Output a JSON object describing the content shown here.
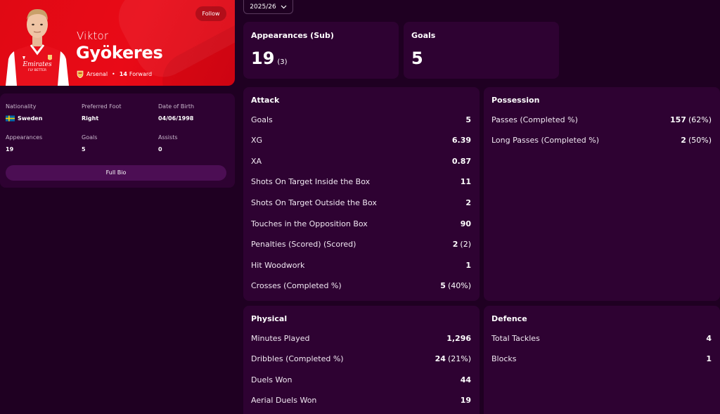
{
  "profile": {
    "first_name": "Viktor",
    "last_name": "Gyökeres",
    "club": "Arsenal",
    "shirt_number": "14",
    "position": "Forward",
    "follow_label": "Follow",
    "shirt_sponsor_line1": "Emirates",
    "shirt_sponsor_line2": "FLY BETTER"
  },
  "bio": {
    "nationality_label": "Nationality",
    "nationality": "Sweden",
    "foot_label": "Preferred Foot",
    "foot": "Right",
    "dob_label": "Date of Birth",
    "dob": "04/06/1998",
    "appearances_label": "Appearances",
    "appearances": "19",
    "goals_label": "Goals",
    "goals": "5",
    "assists_label": "Assists",
    "assists": "0",
    "full_bio_label": "Full Bio"
  },
  "season": {
    "selected": "2025/26"
  },
  "summary": {
    "appearances_label": "Appearances (Sub)",
    "appearances": "19",
    "appearances_sub": "(3)",
    "goals_label": "Goals",
    "goals": "5"
  },
  "attack": {
    "title": "Attack",
    "rows": [
      {
        "name": "Goals",
        "value": "5",
        "extra": ""
      },
      {
        "name": "XG",
        "value": "6.39",
        "extra": ""
      },
      {
        "name": "XA",
        "value": "0.87",
        "extra": ""
      },
      {
        "name": "Shots On Target Inside the Box",
        "value": "11",
        "extra": ""
      },
      {
        "name": "Shots On Target Outside the Box",
        "value": "2",
        "extra": ""
      },
      {
        "name": "Touches in the Opposition Box",
        "value": "90",
        "extra": ""
      },
      {
        "name": "Penalties (Scored) (Scored)",
        "value": "2",
        "extra": "(2)"
      },
      {
        "name": "Hit Woodwork",
        "value": "1",
        "extra": ""
      },
      {
        "name": "Crosses (Completed %)",
        "value": "5",
        "extra": "(40%)"
      }
    ]
  },
  "possession": {
    "title": "Possession",
    "rows": [
      {
        "name": "Passes (Completed %)",
        "value": "157",
        "extra": "(62%)"
      },
      {
        "name": "Long Passes (Completed %)",
        "value": "2",
        "extra": "(50%)"
      }
    ]
  },
  "physical": {
    "title": "Physical",
    "rows": [
      {
        "name": "Minutes Played",
        "value": "1,296",
        "extra": ""
      },
      {
        "name": "Dribbles (Completed %)",
        "value": "24",
        "extra": "(21%)"
      },
      {
        "name": "Duels Won",
        "value": "44",
        "extra": ""
      },
      {
        "name": "Aerial Duels Won",
        "value": "19",
        "extra": ""
      }
    ]
  },
  "defence": {
    "title": "Defence",
    "rows": [
      {
        "name": "Total Tackles",
        "value": "4",
        "extra": ""
      },
      {
        "name": "Blocks",
        "value": "1",
        "extra": ""
      }
    ]
  },
  "colors": {
    "brand_red": "#e00914",
    "background": "#1f0022",
    "card": "#2e0232",
    "button": "#4c0e54"
  }
}
